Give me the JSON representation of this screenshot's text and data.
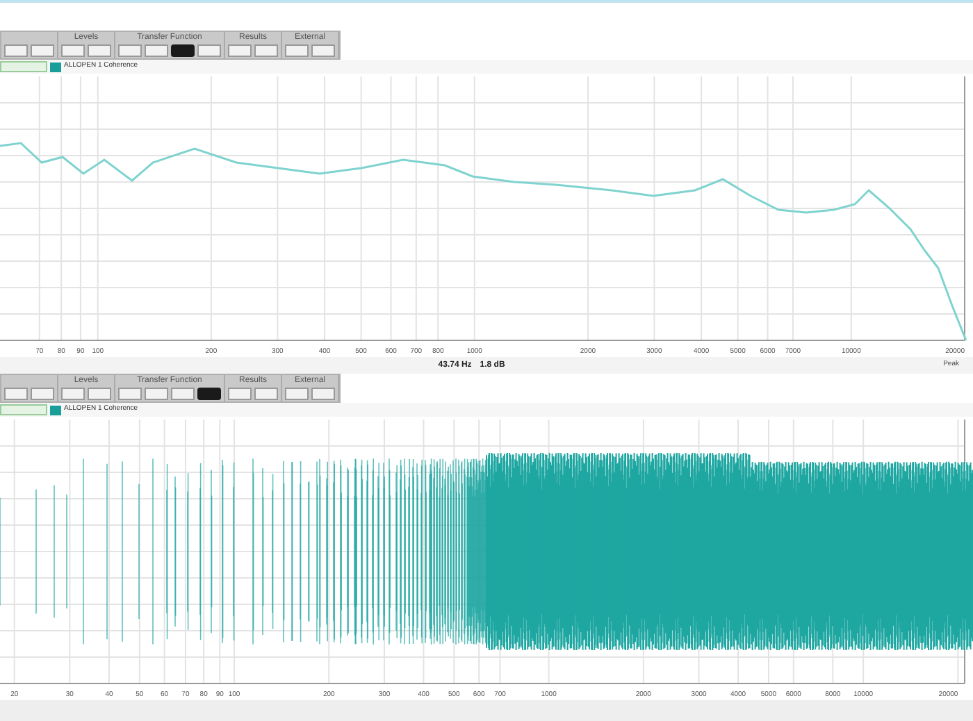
{
  "panels": [
    {
      "toolbar": {
        "groups": [
          {
            "buttons": [
              {
                "selected": false
              },
              {
                "selected": false
              }
            ]
          },
          {
            "label": "Levels",
            "buttons": [
              {
                "selected": false
              },
              {
                "selected": false
              }
            ]
          },
          {
            "label": "Transfer Function",
            "buttons": [
              {
                "selected": false
              },
              {
                "selected": false
              },
              {
                "selected": true
              },
              {
                "selected": false
              }
            ]
          },
          {
            "label": "Results",
            "buttons": [
              {
                "selected": false
              },
              {
                "selected": false
              }
            ]
          },
          {
            "label": "External",
            "buttons": [
              {
                "selected": false
              },
              {
                "selected": false
              }
            ]
          }
        ]
      },
      "legend": {
        "label": "ALLOPEN 1 Coherence",
        "color": "#1a9e9a"
      },
      "plot": {
        "kind": "curve",
        "xticks": [
          "70",
          "80",
          "90",
          "100",
          "200",
          "300",
          "400",
          "500",
          "600",
          "700",
          "800",
          "1000",
          "2000",
          "3000",
          "4000",
          "5000",
          "6000",
          "7000",
          "10000",
          "20000"
        ]
      },
      "readout": {
        "frequency": "43.74 Hz",
        "level": "1.8 dB",
        "peak": "Peak"
      }
    },
    {
      "toolbar": {
        "groups": [
          {
            "buttons": [
              {
                "selected": false
              },
              {
                "selected": false
              }
            ]
          },
          {
            "label": "Levels",
            "buttons": [
              {
                "selected": false
              },
              {
                "selected": false
              }
            ]
          },
          {
            "label": "Transfer Function",
            "buttons": [
              {
                "selected": false
              },
              {
                "selected": false
              },
              {
                "selected": false
              },
              {
                "selected": true
              }
            ]
          },
          {
            "label": "Results",
            "buttons": [
              {
                "selected": false
              },
              {
                "selected": false
              }
            ]
          },
          {
            "label": "External",
            "buttons": [
              {
                "selected": false
              },
              {
                "selected": false
              }
            ]
          }
        ]
      },
      "legend": {
        "label": "ALLOPEN 1 Coherence",
        "color": "#1a9e9a"
      },
      "plot": {
        "kind": "waveform",
        "xticks": [
          "20",
          "30",
          "40",
          "50",
          "60",
          "70",
          "80",
          "90",
          "100",
          "200",
          "300",
          "400",
          "500",
          "600",
          "700",
          "1000",
          "2000",
          "3000",
          "4000",
          "5000",
          "6000",
          "8000",
          "10000",
          "20000"
        ]
      }
    }
  ]
}
